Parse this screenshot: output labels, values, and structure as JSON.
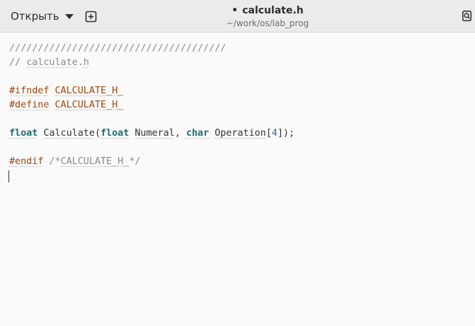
{
  "header": {
    "open_label": "Открыть",
    "title_marker": "•",
    "title": "calculate.h",
    "subtitle": "~/work/os/lab_prog"
  },
  "icons": {
    "open_dropdown": "caret-down-icon",
    "new_tab": "new-tab-icon",
    "search": "search-icon"
  },
  "editor": {
    "line1": {
      "comment": "//////////////////////////////////////"
    },
    "line2": {
      "slashes": "// ",
      "file_word": "calculate",
      "dot": ".",
      "file_ext": "h"
    },
    "line4": {
      "directive": "#ifndef",
      "sp": " ",
      "macro": "CALCULATE_H_"
    },
    "line5": {
      "directive": "#define",
      "sp": " ",
      "macro": "CALCULATE_H_"
    },
    "line7": {
      "kw_float": "float",
      "sp1": " ",
      "func": "Calculate",
      "paren_open": "(",
      "kw_float2": "float",
      "sp2": " ",
      "param1": "Numeral",
      "comma": ", ",
      "kw_char": "char",
      "sp3": " ",
      "param2": "Operation",
      "bracket_open": "[",
      "size": "4",
      "tail": "]);"
    },
    "line9": {
      "directive": "#endif",
      "comment_open": " /*",
      "macro": "CALCULATE_H_",
      "comment_close": "*/"
    }
  },
  "colors": {
    "headerbar": "#ebebeb",
    "editor_bg": "#fafafa",
    "preprocessor": "#a3450a",
    "keyword": "#1a6f73",
    "number": "#3a62b4",
    "comment": "#8a8a8a"
  }
}
